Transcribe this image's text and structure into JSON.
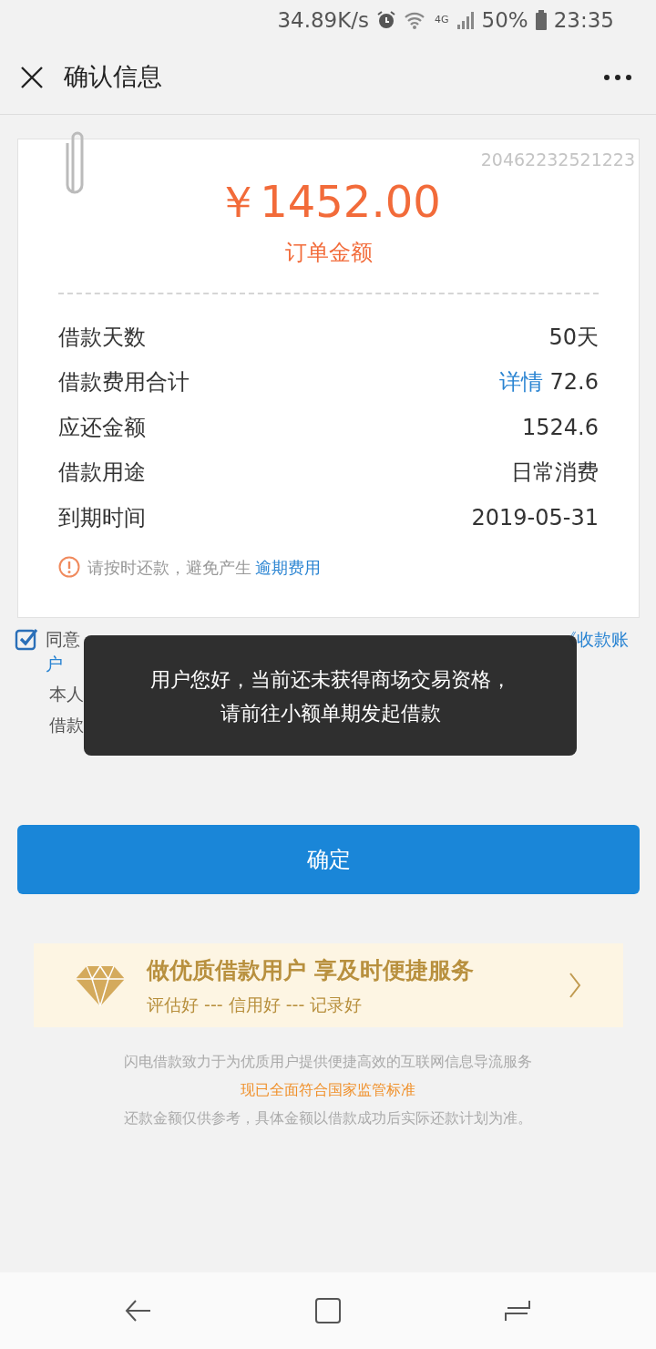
{
  "status_bar": {
    "speed": "34.89K/s",
    "network": "4G",
    "battery": "50%",
    "time": "23:35"
  },
  "header": {
    "title": "确认信息"
  },
  "order": {
    "serial": "20462232521223",
    "amount": "￥1452.00",
    "amount_label": "订单金额",
    "rows": [
      {
        "label": "借款天数",
        "value": "50天"
      },
      {
        "label": "借款费用合计",
        "link": "详情",
        "value": "72.6"
      },
      {
        "label": "应还金额",
        "value": "1524.6"
      },
      {
        "label": "借款用途",
        "value": "日常消费"
      },
      {
        "label": "到期时间",
        "value": "2019-05-31"
      }
    ],
    "notice": {
      "text": "请按时还款，避免产生",
      "link": "逾期费用"
    }
  },
  "agreement": {
    "checked": true,
    "prefix": "同意",
    "link_fragments": [
      "《收款账",
      "户"
    ],
    "lines": [
      "本人",
      "借款"
    ]
  },
  "toast": {
    "lines": [
      "用户您好，当前还未获得商场交易资格，",
      "请前往小额单期发起借款"
    ]
  },
  "confirm_button": "确定",
  "banner": {
    "title": "做优质借款用户 享及时便捷服务",
    "subtitle": "评估好 --- 信用好 --- 记录好"
  },
  "footer": [
    {
      "text": "闪电借款致力于为优质用户提供便捷高效的互联网信息导流服务",
      "kind": "plain"
    },
    {
      "text": "现已全面符合国家监管标准",
      "kind": "highlight"
    },
    {
      "text": "还款金额仅供参考，具体金额以借款成功后实际还款计划为准。",
      "kind": "plain"
    }
  ]
}
